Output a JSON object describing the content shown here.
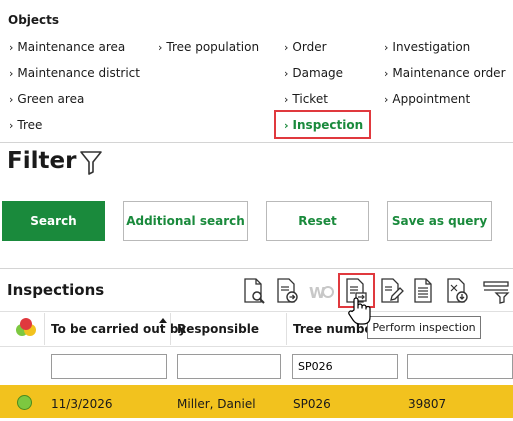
{
  "objects": {
    "title": "Objects",
    "links": [
      {
        "id": "maintenance-area",
        "label": "Maintenance area"
      },
      {
        "id": "tree-population",
        "label": "Tree population"
      },
      {
        "id": "order",
        "label": "Order"
      },
      {
        "id": "investigation",
        "label": "Investigation"
      },
      {
        "id": "maintenance-district",
        "label": "Maintenance district"
      },
      {
        "id": "damage",
        "label": "Damage"
      },
      {
        "id": "maintenance-order",
        "label": "Maintenance order"
      },
      {
        "id": "green-area",
        "label": "Green area"
      },
      {
        "id": "ticket",
        "label": "Ticket"
      },
      {
        "id": "appointment",
        "label": "Appointment"
      },
      {
        "id": "tree",
        "label": "Tree"
      },
      {
        "id": "inspection",
        "label": "Inspection",
        "active": true
      }
    ]
  },
  "filter": {
    "title": "Filter",
    "buttons": {
      "search": "Search",
      "additional_search": "Additional search",
      "reset": "Reset",
      "save_as_query": "Save as query"
    }
  },
  "inspections": {
    "title": "Inspections",
    "toolbar_icons": [
      "search-document-icon",
      "document-forward-icon",
      "wo-disabled-icon",
      "perform-inspection-icon",
      "edit-document-icon",
      "document-lines-icon",
      "document-download-icon",
      "filter-rows-icon"
    ],
    "tooltip": "Perform inspection",
    "columns": {
      "carried_out_by": "To be carried out by",
      "responsible": "Responsible",
      "tree_number": "Tree number"
    },
    "filters": {
      "carried_out_by": "",
      "responsible": "",
      "tree_number": "SP026",
      "extra": ""
    },
    "rows": [
      {
        "status_color": "#7dc840",
        "carried_out_by": "11/3/2026",
        "responsible": "Miller, Daniel",
        "tree_number": "SP026",
        "extra": "39807"
      }
    ]
  },
  "colors": {
    "accent_green": "#1a8a3c",
    "highlight_red": "#e0393e",
    "selected_row": "#f2c21e"
  }
}
